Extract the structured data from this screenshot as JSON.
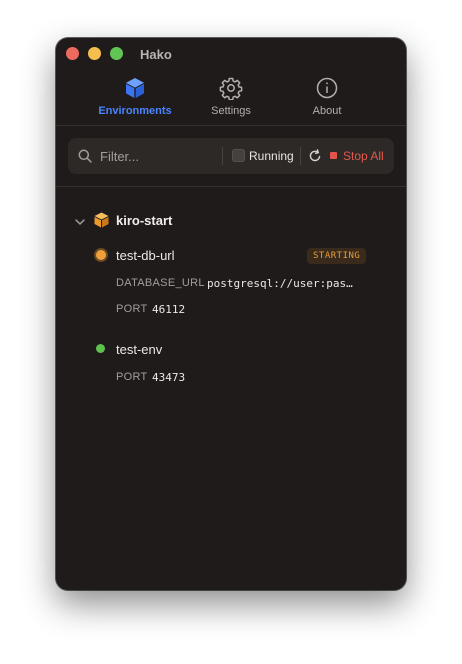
{
  "window": {
    "title": "Hako"
  },
  "tabs": [
    {
      "label": "Environments",
      "icon": "cube-icon",
      "active": true
    },
    {
      "label": "Settings",
      "icon": "gear-icon",
      "active": false
    },
    {
      "label": "About",
      "icon": "info-icon",
      "active": false
    }
  ],
  "toolbar": {
    "filter_placeholder": "Filter...",
    "running_label": "Running",
    "running_checked": false,
    "stop_all_label": "Stop All"
  },
  "groups": [
    {
      "name": "kiro-start",
      "expanded": true,
      "environments": [
        {
          "name": "test-db-url",
          "status": "STARTING",
          "status_color": "#f1a03a",
          "vars": [
            {
              "key": "DATABASE_URL",
              "value": "postgresql://user:pas…"
            },
            {
              "key": "PORT",
              "value": "46112"
            }
          ]
        },
        {
          "name": "test-env",
          "status_color": "#5fc24e",
          "vars": [
            {
              "key": "PORT",
              "value": "43473"
            }
          ]
        }
      ]
    }
  ],
  "colors": {
    "accent": "#4a84ff",
    "background": "#1e1b1a",
    "stop": "#e8584d",
    "starting": "#e69b3c",
    "running": "#5fc24e"
  }
}
